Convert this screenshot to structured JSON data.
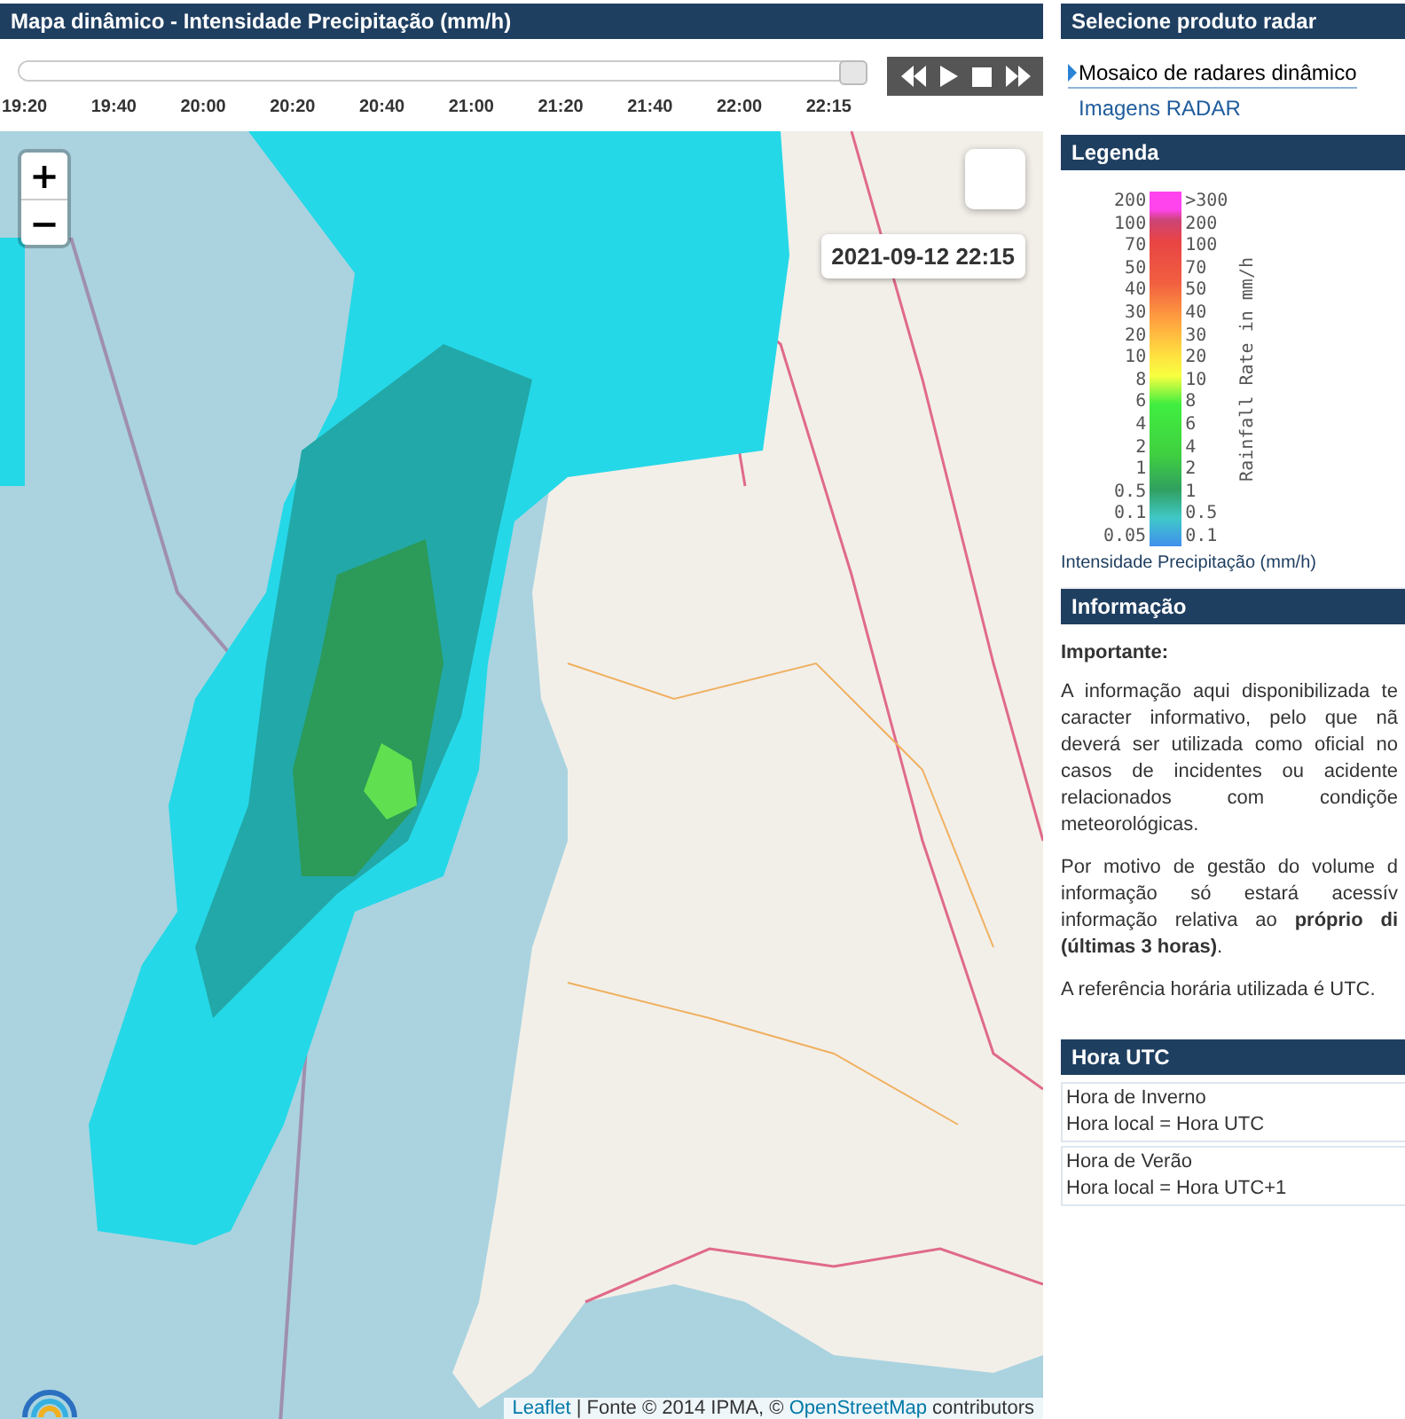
{
  "map_panel": {
    "title": "Mapa dinâmico - Intensidade Precipitação (mm/h)",
    "timeline": {
      "level": 1,
      "ticks": [
        "19:20",
        "19:40",
        "20:00",
        "20:20",
        "20:40",
        "21:00",
        "21:20",
        "21:40",
        "22:00",
        "22:15"
      ]
    },
    "map": {
      "timestamp": "2021-09-12 22:15",
      "zoom_in": "+",
      "zoom_out": "−",
      "attribution": [
        {
          "kind": "link",
          "text": "Leaflet"
        },
        {
          "kind": "text",
          "text": " | Fonte © 2014 IPMA, © "
        },
        {
          "kind": "link",
          "text": "OpenStreetMap"
        },
        {
          "kind": "text",
          "text": " contributors"
        }
      ]
    }
  },
  "product_panel": {
    "title": "Selecione produto radar",
    "items": [
      {
        "label": "Mosaico de radares dinâmico",
        "selected": true
      },
      {
        "label": "Imagens RADAR",
        "selected": false
      }
    ]
  },
  "legend_panel": {
    "title": "Legenda",
    "left_labels": [
      "200",
      "100",
      "70",
      "50",
      "40",
      "30",
      "20",
      "10",
      "8",
      "6",
      "4",
      "2",
      "1",
      "0.5",
      "0.1",
      "0.05"
    ],
    "right_labels": [
      ">300",
      "200",
      "100",
      "70",
      "50",
      "40",
      "30",
      "20",
      "10",
      "8",
      "6",
      "4",
      "2",
      "1",
      "0.5",
      "0.1"
    ],
    "axis_title": "Rainfall Rate in mm/h",
    "caption": "Intensidade Precipitação (mm/h)"
  },
  "info_panel": {
    "title": "Informação",
    "lead": "Importante:",
    "paragraphs": [
      {
        "lines": [
          "A informação aqui disponibilizada te",
          "caracter informativo, pelo que nã",
          "deverá ser utilizada como oficial no",
          "casos de incidentes ou acidente",
          "relacionados com condiçõe",
          "meteorológicas."
        ]
      },
      {
        "lines": [
          "Por motivo de gestão do volume d",
          "informação só estará acessív",
          "informação relativa ao **próprio di**",
          "**(últimas 3 horas)**."
        ]
      },
      {
        "lines": [
          "A referência horária utilizada é UTC."
        ]
      }
    ]
  },
  "utc_panel": {
    "title": "Hora UTC",
    "entries": [
      {
        "name": "Hora de Inverno",
        "rule": "Hora local = Hora UTC"
      },
      {
        "name": "Hora de Verão",
        "rule": "Hora local = Hora UTC+1"
      }
    ]
  }
}
